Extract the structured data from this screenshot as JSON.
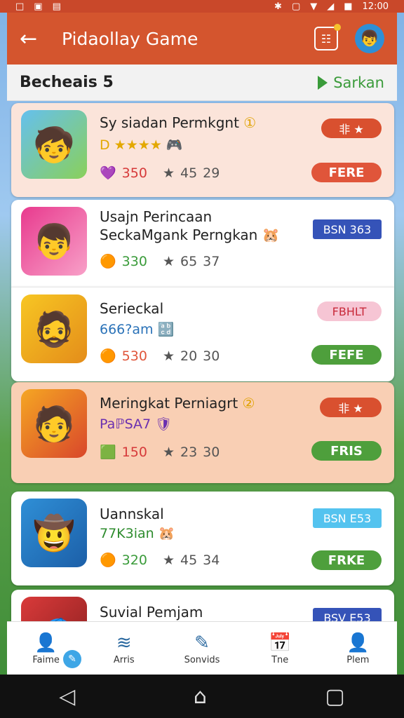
{
  "status": {
    "time": "12:00",
    "icons_left": [
      "□",
      "▣",
      "▤"
    ],
    "icons_right": [
      "✱",
      "▢",
      "▼",
      "◢",
      "■"
    ]
  },
  "appbar": {
    "back": "←",
    "title": "Pidaollay Game",
    "icon1": "☷",
    "avatar": "👦"
  },
  "subbar": {
    "title": "Becheais 5",
    "sort_label": "Sarkan"
  },
  "items": [
    {
      "name": "Sy  siadan Permkgnt",
      "name_emoji": "①",
      "sub": "D ★★★★",
      "sub_emoji": "🎮",
      "stat1": "350",
      "stat1_icon": "💜",
      "stat2": "45",
      "stat3": "29",
      "badge": "非 ★",
      "button": "FERE",
      "thumb": "🧒"
    },
    {
      "name": "Usajn Perincaan",
      "name2": "SeckaMgank Perngkan",
      "name_emoji": "🐹",
      "stat1": "330",
      "stat1_icon": "🟠",
      "stat2": "65",
      "stat3": "37",
      "badge": "BSN 363",
      "thumb": "👦"
    },
    {
      "name": "Serieckal",
      "sub": "666?am",
      "sub_emoji": "🔡",
      "stat1": "530",
      "stat1_icon": "🟠",
      "stat2": "20",
      "stat3": "30",
      "badge": "FBHLT",
      "button": "FEFE",
      "thumb": "🧔"
    },
    {
      "name": "Meringkat Perniagrt",
      "name_emoji": "②",
      "sub": "PaℙSA7",
      "sub_emoji": "🛡",
      "stat1": "150",
      "stat1_icon": "🟩",
      "stat2": "23",
      "stat3": "30",
      "badge": "非 ★",
      "button": "FRIS",
      "thumb": "🧑"
    },
    {
      "name": "Uannskal",
      "sub": "77K3ian",
      "sub_emoji": "🐹",
      "stat1": "320",
      "stat1_icon": "🟠",
      "stat2": "45",
      "stat3": "34",
      "badge": "BSN E53",
      "button": "FRKE",
      "thumb": "🤠"
    },
    {
      "name": "Suvial Pemjam",
      "badge": "BSV E53",
      "thumb": "🧢"
    }
  ],
  "nav": [
    {
      "label": "Faime",
      "icon": "👤"
    },
    {
      "label": "Arris",
      "icon": "≋"
    },
    {
      "label": "Sonvids",
      "icon": "✎"
    },
    {
      "label": "Tne",
      "icon": "📅"
    },
    {
      "label": "Plem",
      "icon": "👤"
    }
  ],
  "fab_icon": "✎",
  "sysnav": {
    "back": "◁",
    "home": "⌂",
    "recent": "▢"
  },
  "colors": {
    "appbar": "#d4552e",
    "green": "#4e9f3c",
    "red": "#e0553a",
    "blue": "#3553b8",
    "lightblue": "#54c3ef"
  }
}
